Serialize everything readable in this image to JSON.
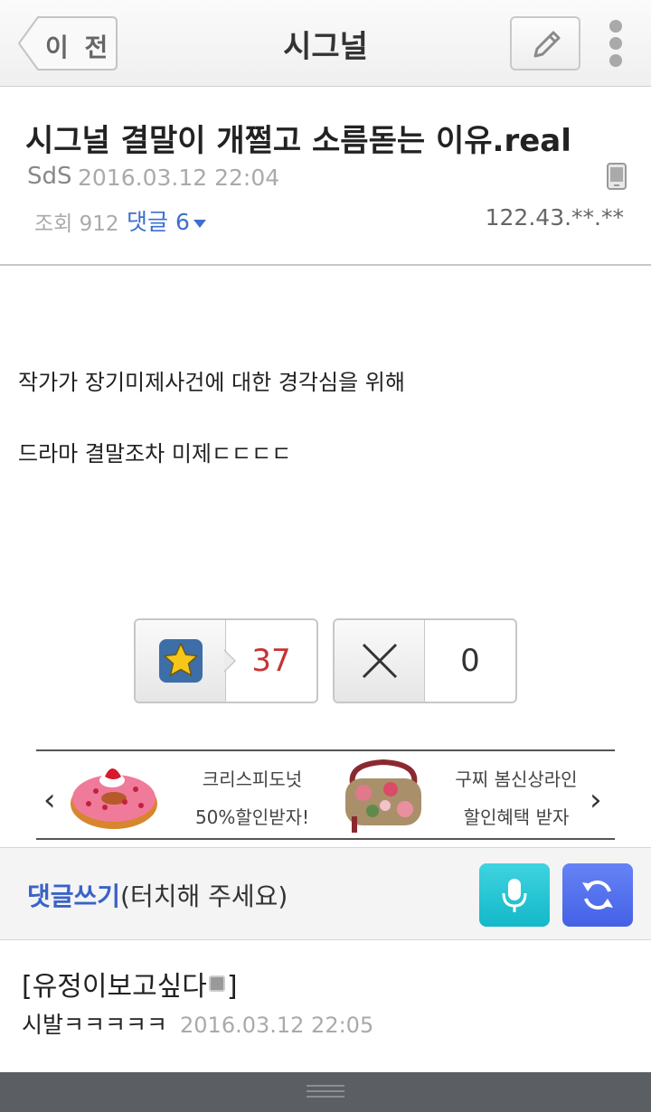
{
  "topbar": {
    "back_label": "이 전",
    "title": "시그널",
    "edit_icon": "pencil-icon",
    "more_icon": "more-vertical-icon"
  },
  "post": {
    "title": "시그널 결말이 개쩔고 소름돋는 이유.real",
    "author": "SdS",
    "date": "2016.03.12 22:04",
    "device_icon": "mobile-device-icon",
    "views": "조회 912",
    "comments_link": "댓글 6",
    "ip": "122.43.**.**",
    "body": [
      "작가가 장기미제사건에 대한 경각심을 위해",
      "드라마 결말조차 미제ㄷㄷㄷㄷ"
    ]
  },
  "votes": {
    "up_icon": "star-icon",
    "up_count": "37",
    "down_icon": "x-icon",
    "down_count": "0"
  },
  "ads": {
    "left_arrow": "‹",
    "right_arrow": "›",
    "items": [
      {
        "icon": "donut-image",
        "line1": "크리스피도넛",
        "line2": "50%할인받자!"
      },
      {
        "icon": "handbag-image",
        "line1": "구찌 봄신상라인",
        "line2": "할인혜택 받자"
      }
    ]
  },
  "comment_bar": {
    "label_em": "댓글쓰기",
    "label_hint": "(터치해 주세요)",
    "mic_icon": "microphone-icon",
    "refresh_icon": "refresh-icon",
    "colors": {
      "mic": "#1fc0d1",
      "refresh": "#4d6ae9",
      "accent": "#3a62c8"
    }
  },
  "comments": [
    {
      "author_open": "[유정이보고싶다",
      "author_close": "]",
      "text": "시발ㅋㅋㅋㅋㅋ",
      "date": "2016.03.12 22:05"
    }
  ]
}
